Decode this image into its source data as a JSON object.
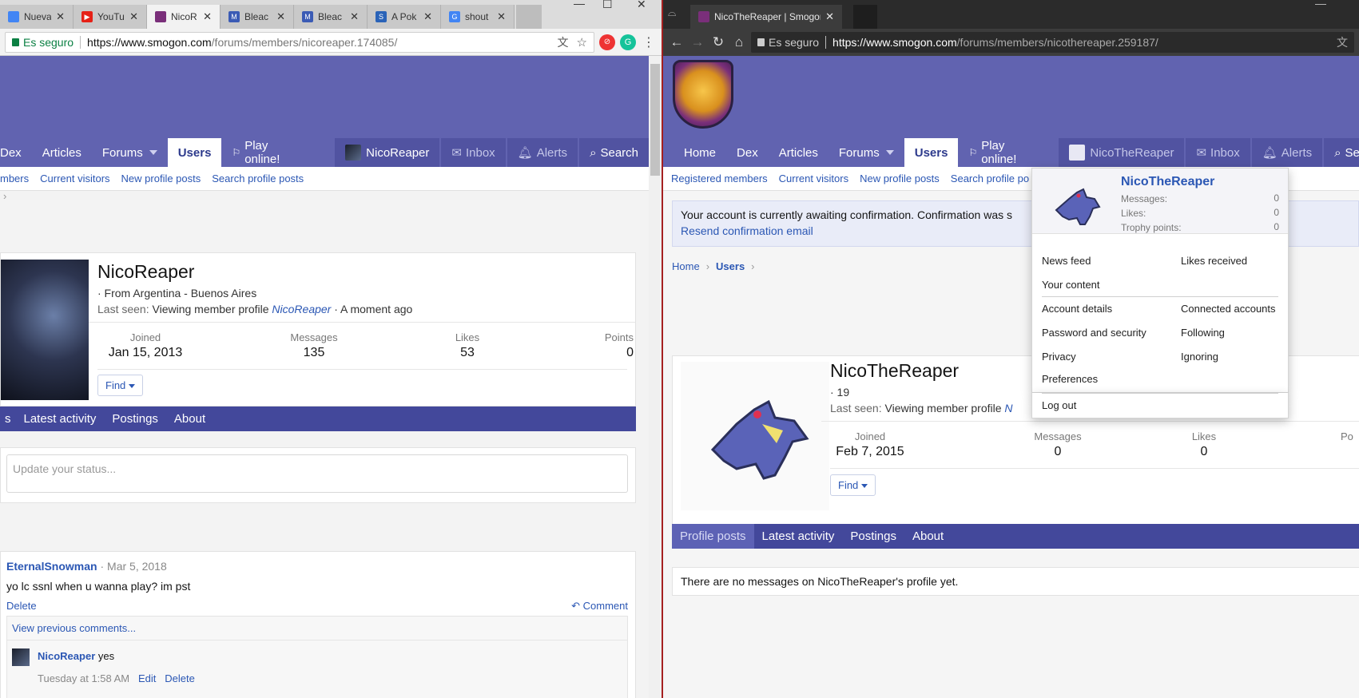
{
  "left": {
    "tabs": [
      {
        "label": "Nueva pe",
        "color": "#4285f4",
        "letter": ""
      },
      {
        "label": "YouTu",
        "color": "#e62117",
        "letter": "▶"
      },
      {
        "label": "NicoR",
        "color": "#7a2f7a",
        "letter": "",
        "active": true
      },
      {
        "label": "Bleac",
        "color": "#3b5bb5",
        "letter": "M"
      },
      {
        "label": "Bleac",
        "color": "#3b5bb5",
        "letter": "M"
      },
      {
        "label": "A Pok",
        "color": "#2a63b8",
        "letter": "S"
      },
      {
        "label": "shout",
        "color": "#4285f4",
        "letter": "G"
      }
    ],
    "secure_label": "Es seguro",
    "url_host": "https://www.smogon.com",
    "url_path": "/forums/members/nicoreaper.174085/",
    "nav": {
      "dex": "Dex",
      "articles": "Articles",
      "forums": "Forums",
      "users": "Users",
      "play": "Play online!",
      "me": "NicoReaper",
      "inbox": "Inbox",
      "alerts": "Alerts",
      "search": "Search"
    },
    "subnav": [
      "mbers",
      "Current visitors",
      "New profile posts",
      "Search profile posts"
    ],
    "crumb_sep": "›",
    "profile": {
      "name": "NicoReaper",
      "location": "· From Argentina - Buenos Aires",
      "last_seen_label": "Last seen:",
      "last_seen_text": "Viewing member profile",
      "last_seen_link": "NicoReaper",
      "last_seen_time": "· A moment ago",
      "joined_label": "Joined",
      "joined": "Jan 15, 2013",
      "messages_label": "Messages",
      "messages": "135",
      "likes_label": "Likes",
      "likes": "53",
      "points_label": "Points",
      "points": "0",
      "find": "Find"
    },
    "tabs_bar": [
      "s",
      "Latest activity",
      "Postings",
      "About"
    ],
    "status_placeholder": "Update your status...",
    "post": {
      "author": "EternalSnowman",
      "date": "· Mar 5, 2018",
      "text": "yo lc ssnl when u wanna play? im pst",
      "delete": "Delete",
      "comment": "Comment",
      "view_prev": "View previous comments...",
      "reply_author": "NicoReaper",
      "reply_text": "yes",
      "reply_time": "Tuesday at 1:58 AM",
      "edit": "Edit",
      "reply_delete": "Delete"
    }
  },
  "right": {
    "tab_label": "NicoTheReaper | Smogon",
    "secure_label": "Es seguro",
    "url_host": "https://www.smogon.com",
    "url_path": "/forums/members/nicothereaper.259187/",
    "nav": {
      "home": "Home",
      "dex": "Dex",
      "articles": "Articles",
      "forums": "Forums",
      "users": "Users",
      "play": "Play online!",
      "me": "NicoTheReaper",
      "inbox": "Inbox",
      "alerts": "Alerts",
      "search": "Sea"
    },
    "subnav": [
      "Registered members",
      "Current visitors",
      "New profile posts",
      "Search profile po"
    ],
    "notice": "Your account is currently awaiting confirmation. Confirmation was s",
    "resend": "Resend confirmation email",
    "crumb_home": "Home",
    "crumb_users": "Users",
    "crumb_sep": "›",
    "profile": {
      "name": "NicoTheReaper",
      "age": "· 19",
      "last_seen_label": "Last seen:",
      "last_seen_text": "Viewing member profile",
      "last_seen_link": "N",
      "joined_label": "Joined",
      "joined": "Feb 7, 2015",
      "messages_label": "Messages",
      "messages": "0",
      "likes_label": "Likes",
      "likes": "0",
      "points_label": "Po",
      "find": "Find"
    },
    "tabs_bar": [
      "Profile posts",
      "Latest activity",
      "Postings",
      "About"
    ],
    "no_messages": "There are no messages on NicoTheReaper's profile yet.",
    "dropdown": {
      "name": "NicoTheReaper",
      "messages_label": "Messages:",
      "messages": "0",
      "likes_label": "Likes:",
      "likes": "0",
      "trophy_label": "Trophy points:",
      "trophy": "0",
      "news_feed": "News feed",
      "likes_received": "Likes received",
      "your_content": "Your content",
      "account_details": "Account details",
      "connected_accounts": "Connected accounts",
      "password_security": "Password and security",
      "following": "Following",
      "privacy": "Privacy",
      "ignoring": "Ignoring",
      "preferences": "Preferences",
      "log_out": "Log out"
    }
  }
}
